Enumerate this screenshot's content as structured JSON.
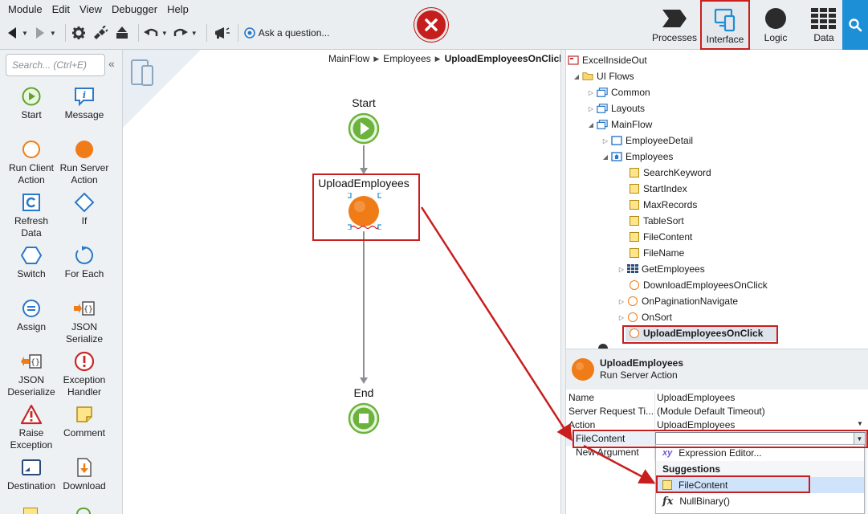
{
  "menu": [
    "Module",
    "Edit",
    "View",
    "Debugger",
    "Help"
  ],
  "toolbar": {
    "ask_label": "Ask a question..."
  },
  "tabs": [
    {
      "label": "Processes",
      "icon": "processes-icon"
    },
    {
      "label": "Interface",
      "icon": "interface-icon",
      "selected": true
    },
    {
      "label": "Logic",
      "icon": "logic-icon"
    },
    {
      "label": "Data",
      "icon": "data-icon"
    }
  ],
  "toolbox": {
    "search_placeholder": "Search... (Ctrl+E)",
    "tools": [
      {
        "label": "Start",
        "icon": "start-icon"
      },
      {
        "label": "Message",
        "icon": "message-icon"
      },
      {
        "label": "Run Client Action",
        "icon": "run-client-action-icon"
      },
      {
        "label": "Run Server Action",
        "icon": "run-server-action-icon"
      },
      {
        "label": "Refresh Data",
        "icon": "refresh-data-icon"
      },
      {
        "label": "If",
        "icon": "if-icon"
      },
      {
        "label": "Switch",
        "icon": "switch-icon"
      },
      {
        "label": "For Each",
        "icon": "for-each-icon"
      },
      {
        "label": "Assign",
        "icon": "assign-icon"
      },
      {
        "label": "JSON Serialize",
        "icon": "json-serialize-icon"
      },
      {
        "label": "JSON Deserialize",
        "icon": "json-deserialize-icon"
      },
      {
        "label": "Exception Handler",
        "icon": "exception-handler-icon"
      },
      {
        "label": "Raise Exception",
        "icon": "raise-exception-icon"
      },
      {
        "label": "Comment",
        "icon": "comment-icon"
      },
      {
        "label": "Destination",
        "icon": "destination-icon"
      },
      {
        "label": "Download",
        "icon": "download-icon"
      }
    ]
  },
  "canvas": {
    "breadcrumb": [
      "MainFlow",
      "Employees",
      "UploadEmployeesOnClick"
    ],
    "nodes": {
      "start": "Start",
      "action": "UploadEmployees",
      "end": "End"
    }
  },
  "tree": [
    {
      "label": "ExcelInsideOut",
      "level": 0,
      "icon": "module-icon",
      "expander": ""
    },
    {
      "label": "UI Flows",
      "level": 1,
      "icon": "folder-icon",
      "expander": "◢"
    },
    {
      "label": "Common",
      "level": 2,
      "icon": "flow-icon",
      "expander": "▷"
    },
    {
      "label": "Layouts",
      "level": 2,
      "icon": "flow-icon",
      "expander": "▷"
    },
    {
      "label": "MainFlow",
      "level": 2,
      "icon": "flow-icon",
      "expander": "◢"
    },
    {
      "label": "EmployeeDetail",
      "level": 3,
      "icon": "screen-icon",
      "expander": "▷"
    },
    {
      "label": "Employees",
      "level": 3,
      "icon": "screen-home-icon",
      "expander": "◢"
    },
    {
      "label": "SearchKeyword",
      "level": 4,
      "icon": "variable-icon",
      "expander": ""
    },
    {
      "label": "StartIndex",
      "level": 4,
      "icon": "variable-icon",
      "expander": ""
    },
    {
      "label": "MaxRecords",
      "level": 4,
      "icon": "variable-icon",
      "expander": ""
    },
    {
      "label": "TableSort",
      "level": 4,
      "icon": "variable-icon",
      "expander": ""
    },
    {
      "label": "FileContent",
      "level": 4,
      "icon": "variable-icon",
      "expander": ""
    },
    {
      "label": "FileName",
      "level": 4,
      "icon": "variable-icon",
      "expander": ""
    },
    {
      "label": "GetEmployees",
      "level": 4,
      "icon": "aggregate-icon",
      "expander": "▷"
    },
    {
      "label": "DownloadEmployeesOnClick",
      "level": 4,
      "icon": "client-action-icon",
      "expander": ""
    },
    {
      "label": "OnPaginationNavigate",
      "level": 4,
      "icon": "client-action-icon",
      "expander": "▷"
    },
    {
      "label": "OnSort",
      "level": 4,
      "icon": "client-action-icon",
      "expander": "▷"
    },
    {
      "label": "UploadEmployeesOnClick",
      "level": 4,
      "icon": "client-action-icon",
      "expander": "",
      "highlighted": true
    }
  ],
  "properties": {
    "title": "UploadEmployees",
    "type": "Run Server Action",
    "rows": [
      {
        "key": "Name",
        "value": "UploadEmployees"
      },
      {
        "key": "Server Request Ti...",
        "value": "(Module Default Timeout)"
      },
      {
        "key": "Action",
        "value": "UploadEmployees"
      },
      {
        "key": "FileContent",
        "value": ""
      },
      {
        "key": "New Argument",
        "value": ""
      }
    ]
  },
  "suggestions": {
    "expression_editor": "Expression Editor...",
    "header": "Suggestions",
    "items": [
      {
        "label": "FileContent",
        "icon": "variable-icon",
        "selected": true
      },
      {
        "label": "NullBinary()",
        "icon": "function-icon",
        "selected": false
      }
    ]
  },
  "colors": {
    "accent": "#1d8fd6",
    "highlight": "#c81e1e",
    "orange": "#f07c18",
    "green": "#6cb33e"
  }
}
